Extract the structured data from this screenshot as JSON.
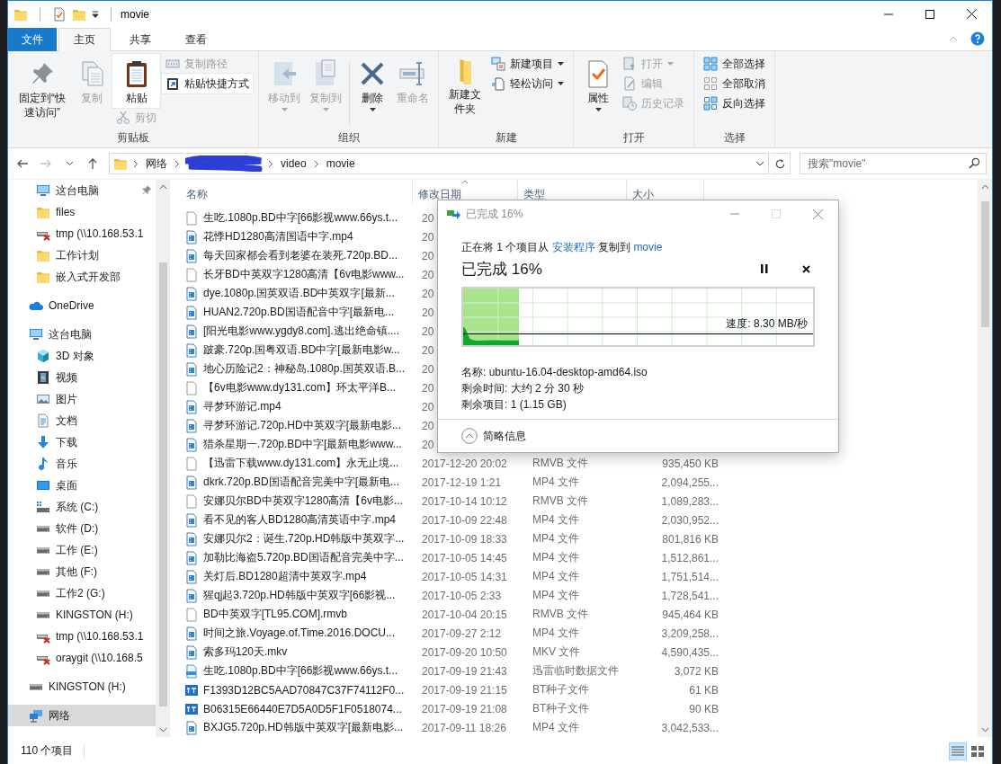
{
  "window": {
    "title": "movie"
  },
  "ribbon_tabs": [
    {
      "label": "文件",
      "kind": "file",
      "selected": false
    },
    {
      "label": "主页",
      "kind": "tab",
      "selected": true
    },
    {
      "label": "共享",
      "kind": "tab",
      "selected": false
    },
    {
      "label": "查看",
      "kind": "tab",
      "selected": false
    }
  ],
  "ribbon_groups": [
    {
      "label": "剪贴板",
      "columns": [
        {
          "kind": "stack",
          "items": [
            {
              "label": "固定到“快速访问”",
              "kind": "large",
              "disabled": false,
              "highlighted": false,
              "dropdown": false
            }
          ]
        },
        {
          "kind": "stack",
          "items": [
            {
              "label": "复制",
              "kind": "large",
              "disabled": true,
              "highlighted": false,
              "dropdown": false
            }
          ]
        },
        {
          "kind": "stack",
          "items": [
            {
              "label": "粘贴",
              "kind": "large",
              "disabled": false,
              "highlighted": true,
              "dropdown": false
            },
            {
              "label": "剪切",
              "kind": "small",
              "disabled": true,
              "highlighted": false,
              "dropdown": false
            }
          ]
        },
        {
          "kind": "stack",
          "items": [
            {
              "label": "复制路径",
              "kind": "small",
              "disabled": true,
              "highlighted": false,
              "dropdown": false
            },
            {
              "label": "粘贴快捷方式",
              "kind": "small",
              "disabled": false,
              "highlighted": true,
              "dropdown": false
            }
          ]
        }
      ]
    },
    {
      "label": "组织",
      "columns": [
        {
          "kind": "stack",
          "items": [
            {
              "label": "移动到",
              "kind": "large",
              "disabled": true,
              "highlighted": false,
              "dropdown": true
            }
          ]
        },
        {
          "kind": "stack",
          "items": [
            {
              "label": "复制到",
              "kind": "large",
              "disabled": true,
              "highlighted": false,
              "dropdown": true
            }
          ]
        },
        {
          "kind": "separator"
        },
        {
          "kind": "stack",
          "items": [
            {
              "label": "删除",
              "kind": "large",
              "disabled": false,
              "highlighted": false,
              "dropdown": true
            }
          ]
        },
        {
          "kind": "stack",
          "items": [
            {
              "label": "重命名",
              "kind": "large",
              "disabled": true,
              "highlighted": false,
              "dropdown": false
            }
          ]
        }
      ]
    },
    {
      "label": "新建",
      "columns": [
        {
          "kind": "stack",
          "items": [
            {
              "label": "新建文件夹",
              "kind": "large",
              "disabled": false,
              "highlighted": false,
              "dropdown": false
            }
          ]
        },
        {
          "kind": "stack",
          "items": [
            {
              "label": "新建项目",
              "kind": "small",
              "disabled": false,
              "highlighted": false,
              "dropdown": true
            },
            {
              "label": "轻松访问",
              "kind": "small",
              "disabled": false,
              "highlighted": false,
              "dropdown": true
            }
          ]
        }
      ]
    },
    {
      "label": "打开",
      "columns": [
        {
          "kind": "stack",
          "items": [
            {
              "label": "属性",
              "kind": "large",
              "disabled": false,
              "highlighted": false,
              "dropdown": true
            }
          ]
        },
        {
          "kind": "stack",
          "items": [
            {
              "label": "打开",
              "kind": "small",
              "disabled": true,
              "highlighted": false,
              "dropdown": true
            },
            {
              "label": "编辑",
              "kind": "small",
              "disabled": true,
              "highlighted": false,
              "dropdown": false
            },
            {
              "label": "历史记录",
              "kind": "small",
              "disabled": true,
              "highlighted": false,
              "dropdown": false
            }
          ]
        }
      ]
    },
    {
      "label": "选择",
      "columns": [
        {
          "kind": "stack",
          "items": [
            {
              "label": "全部选择",
              "kind": "small",
              "disabled": false,
              "highlighted": false,
              "dropdown": false
            },
            {
              "label": "全部取消",
              "kind": "small",
              "disabled": false,
              "highlighted": false,
              "dropdown": false
            },
            {
              "label": "反向选择",
              "kind": "small",
              "disabled": false,
              "highlighted": false,
              "dropdown": false
            }
          ]
        }
      ]
    }
  ],
  "address_bar": {
    "nav_buttons": [
      {
        "kind": "back",
        "disabled": false
      },
      {
        "kind": "forward",
        "disabled": true
      },
      {
        "kind": "recent",
        "disabled": false
      },
      {
        "kind": "up",
        "disabled": false
      }
    ],
    "path": [
      {
        "kind": "text",
        "label": "网络"
      },
      {
        "kind": "redacted"
      },
      {
        "kind": "text",
        "label": "video"
      },
      {
        "kind": "text",
        "label": "movie"
      }
    ],
    "search": {
      "placeholder": "搜索\"movie\""
    }
  },
  "nav_pane": {
    "pinned_items": [
      {
        "label": "这台电脑",
        "kind": "computer",
        "pinned": true,
        "selected": false
      },
      {
        "label": "files",
        "kind": "folder",
        "pinned": false,
        "selected": false
      },
      {
        "label": "tmp (\\\\10.168.53.1",
        "kind": "network-drive-offline",
        "pinned": false,
        "selected": false
      },
      {
        "label": "工作计划",
        "kind": "folder",
        "pinned": false,
        "selected": false
      },
      {
        "label": "嵌入式开发部",
        "kind": "folder",
        "pinned": false,
        "selected": false
      }
    ],
    "items": [
      {
        "label": "OneDrive",
        "kind": "cloud",
        "selected": false
      },
      {
        "label": "这台电脑",
        "kind": "computer",
        "selected": false,
        "children": [
          {
            "label": "3D 对象",
            "kind": "cube",
            "selected": false
          },
          {
            "label": "视频",
            "kind": "film",
            "selected": false
          },
          {
            "label": "图片",
            "kind": "pictures",
            "selected": false
          },
          {
            "label": "文档",
            "kind": "documents",
            "selected": false
          },
          {
            "label": "下载",
            "kind": "downloads",
            "selected": false
          },
          {
            "label": "音乐",
            "kind": "music",
            "selected": false
          },
          {
            "label": "桌面",
            "kind": "desktop",
            "selected": false
          },
          {
            "label": "系统 (C:)",
            "kind": "system-drive",
            "selected": false
          },
          {
            "label": "软件 (D:)",
            "kind": "drive",
            "selected": false
          },
          {
            "label": "工作 (E:)",
            "kind": "drive",
            "selected": false
          },
          {
            "label": "其他 (F:)",
            "kind": "drive",
            "selected": false
          },
          {
            "label": "工作2 (G:)",
            "kind": "drive",
            "selected": false
          },
          {
            "label": "KINGSTON (H:)",
            "kind": "drive",
            "selected": false
          },
          {
            "label": "tmp (\\\\10.168.53.1",
            "kind": "network-drive-offline",
            "selected": false
          },
          {
            "label": "oraygit (\\\\10.168.5",
            "kind": "network-drive-offline",
            "selected": false
          }
        ]
      },
      {
        "label": "KINGSTON (H:)",
        "kind": "drive",
        "selected": false
      },
      {
        "label": "网络",
        "kind": "network",
        "selected": true
      }
    ]
  },
  "file_list": {
    "columns": [
      {
        "label": "名称",
        "sorted": false
      },
      {
        "label": "修改日期",
        "sorted": true
      },
      {
        "label": "类型",
        "sorted": false
      },
      {
        "label": "大小",
        "sorted": false
      }
    ],
    "rows": [
      {
        "kind": "blank",
        "name": "生吃.1080p.BD中字[66影视www.66ys.t...",
        "date": "20"
      },
      {
        "kind": "video",
        "name": "花悸HD1280高清国语中字.mp4",
        "date": "20"
      },
      {
        "kind": "video",
        "name": "每天回家都会看到老婆在装死.720p.BD...",
        "date": "20"
      },
      {
        "kind": "blank",
        "name": "长牙BD中英双字1280高清【6v电影www...",
        "date": "20"
      },
      {
        "kind": "video",
        "name": "dye.1080p.国英双语.BD中英双字[最新...",
        "date": "20"
      },
      {
        "kind": "video",
        "name": "HUAN2.720p.BD国语配音中字[最新电...",
        "date": "20"
      },
      {
        "kind": "video",
        "name": "[阳光电影www.ygdy8.com].逃出绝命镇....",
        "date": "20"
      },
      {
        "kind": "video",
        "name": "跛豪.720p.国粤双语.BD中字[最新电影w...",
        "date": "20"
      },
      {
        "kind": "video",
        "name": "地心历险记2：神秘岛.1080p.国英双语.B...",
        "date": "20"
      },
      {
        "kind": "blank",
        "name": "【6v电影www.dy131.com】环太平洋B...",
        "date": "20"
      },
      {
        "kind": "video",
        "name": "寻梦环游记.mp4",
        "date": "20"
      },
      {
        "kind": "video",
        "name": "寻梦环游记.720p.HD中英双字[最新电影...",
        "date": "20"
      },
      {
        "kind": "video",
        "name": "猎杀星期一.720p.BD中字[最新电影www...",
        "date": "20"
      },
      {
        "kind": "blank",
        "name": "【迅雷下载www.dy131.com】永无止境...",
        "date": "2017-12-20 20:02",
        "type": "RMVB 文件",
        "size": "935,450 KB"
      },
      {
        "kind": "video",
        "name": "dkrk.720p.BD国语配音完美中字[最新电...",
        "date": "2017-12-19 1:21",
        "type": "MP4 文件",
        "size": "2,094,255..."
      },
      {
        "kind": "blank",
        "name": "安娜贝尔BD中英双字1280高清【6v电影...",
        "date": "2017-10-14 10:12",
        "type": "RMVB 文件",
        "size": "1,089,283..."
      },
      {
        "kind": "video",
        "name": "看不见的客人BD1280高清英语中字.mp4",
        "date": "2017-10-09 22:48",
        "type": "MP4 文件",
        "size": "2,030,952..."
      },
      {
        "kind": "video",
        "name": "安娜贝尔2：诞生.720p.HD韩版中英双字...",
        "date": "2017-10-09 18:33",
        "type": "MP4 文件",
        "size": "801,816 KB"
      },
      {
        "kind": "video",
        "name": "加勒比海盗5.720p.BD国语配音完美中字...",
        "date": "2017-10-05 14:45",
        "type": "MP4 文件",
        "size": "1,512,861..."
      },
      {
        "kind": "video",
        "name": "关灯后.BD1280超清中英双字.mp4",
        "date": "2017-10-05 14:31",
        "type": "MP4 文件",
        "size": "1,751,514..."
      },
      {
        "kind": "video",
        "name": "猩qj起3.720p.HD韩版中英双字[66影视...",
        "date": "2017-10-05 2:33",
        "type": "MP4 文件",
        "size": "1,728,541..."
      },
      {
        "kind": "blank",
        "name": "BD中英双字[TL95.COM].rmvb",
        "date": "2017-10-04 20:15",
        "type": "RMVB 文件",
        "size": "945,464 KB"
      },
      {
        "kind": "video",
        "name": "时间之旅.Voyage.of.Time.2016.DOCU...",
        "date": "2017-09-27 2:12",
        "type": "MP4 文件",
        "size": "3,209,258..."
      },
      {
        "kind": "video",
        "name": "索多玛120天.mkv",
        "date": "2017-09-20 10:50",
        "type": "MKV 文件",
        "size": "4,590,435..."
      },
      {
        "kind": "temp",
        "name": "生吃.1080p.BD中字[66影视www.66ys.t...",
        "date": "2017-09-19 21:43",
        "type": "迅雷临时数据文件",
        "size": "3,072 KB"
      },
      {
        "kind": "torrent",
        "name": "F1393D12BC5AAD70847C37F74112F0...",
        "date": "2017-09-19 21:15",
        "type": "BT种子文件",
        "size": "61 KB"
      },
      {
        "kind": "torrent",
        "name": "B06315E66440E7D5A0D5F1F0518074...",
        "date": "2017-09-19 21:08",
        "type": "BT种子文件",
        "size": "90 KB"
      },
      {
        "kind": "video",
        "name": "BXJG5.720p.HD韩版中英双字[最新电影...",
        "date": "2017-09-11 18:26",
        "type": "MP4 文件",
        "size": "3,042,533..."
      }
    ]
  },
  "copy_dialog": {
    "title": "已完成 16%",
    "summary": {
      "prefix": "正在将 1 个项目从",
      "source": "安装程序",
      "middle": "复制到",
      "destination": "movie"
    },
    "heading": "已完成 16%",
    "progress": {
      "level": 0.16
    },
    "speed": "速度: 8.30 MB/秒",
    "details": [
      "名称: ubuntu-16.04-desktop-amd64.iso",
      "剩余时间: 大约 2 分 30 秒",
      "剩余项目: 1 (1.15 GB)"
    ],
    "toggle": "简略信息"
  },
  "status_bar": {
    "item_count": "110 个项目",
    "views": [
      {
        "kind": "details",
        "selected": true
      },
      {
        "kind": "large-icons",
        "selected": false
      }
    ]
  }
}
